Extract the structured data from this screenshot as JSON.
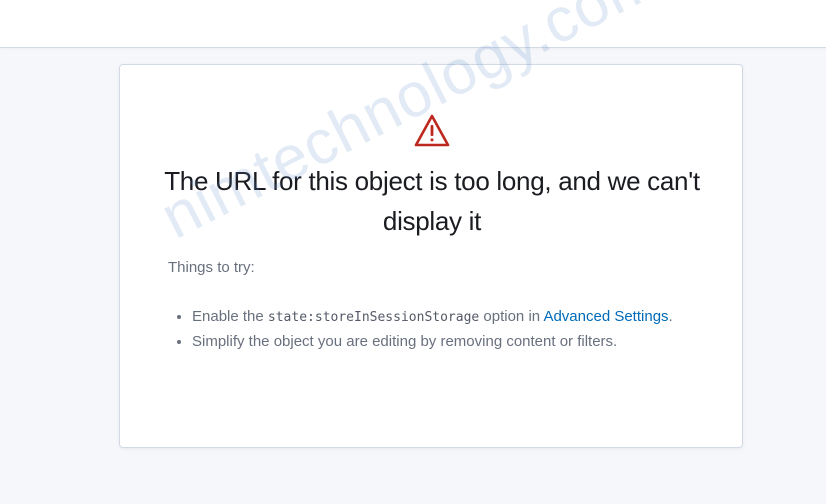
{
  "error": {
    "icon": "warning-icon",
    "title": "The URL for this object is too long, and we can't display it",
    "tips_heading": "Things to try:",
    "tip1": {
      "prefix": "Enable the ",
      "code": "state:storeInSessionStorage",
      "middle": " option in ",
      "link": "Advanced Settings",
      "suffix": "."
    },
    "tip2": "Simplify the object you are editing by removing content or filters."
  },
  "watermark": "nimtechnology.com",
  "colors": {
    "background": "#f5f7fa",
    "panel": "#ffffff",
    "warning": "#bd271e",
    "link": "#006bb8",
    "text": "#69707d",
    "title": "#1a1c21"
  }
}
